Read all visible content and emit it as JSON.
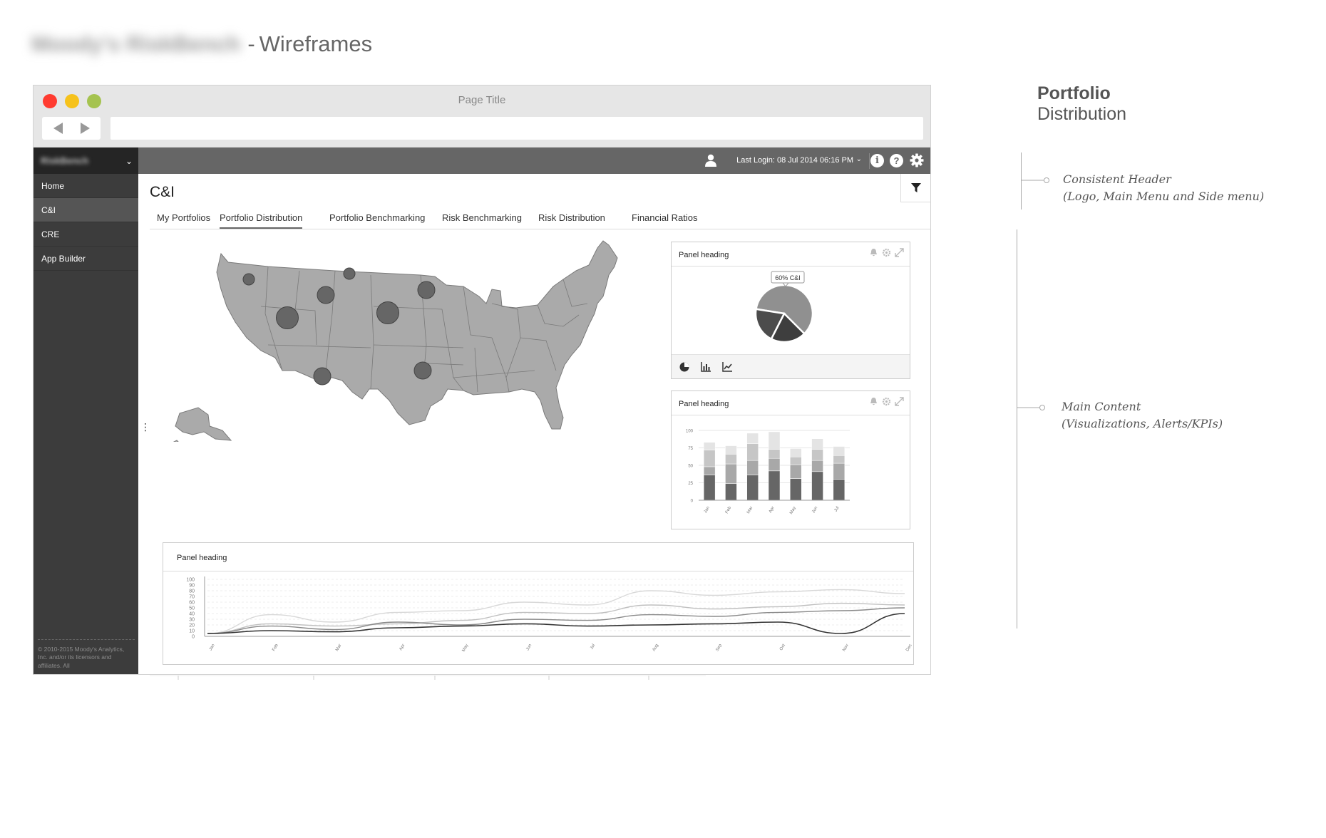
{
  "doc": {
    "title_blurred": "Moody's RiskBench",
    "title_dash": "-",
    "title": "Wireframes"
  },
  "browser": {
    "page_title": "Page Title",
    "url": ""
  },
  "app": {
    "logo_text": "RiskBench",
    "sidebar": {
      "items": [
        {
          "label": "Home",
          "active": false
        },
        {
          "label": "C&I",
          "active": true
        },
        {
          "label": "CRE",
          "active": false
        },
        {
          "label": "App Builder",
          "active": false
        }
      ],
      "copyright": "© 2010-2015 Moody's Analytics, Inc. and/or its licensors and affiliates. All"
    },
    "topbar": {
      "last_login": "Last Login: 08 Jul 2014 06:16 PM",
      "icons": [
        "user-icon",
        "info-icon",
        "help-icon",
        "gear-icon"
      ]
    },
    "section_title": "C&I",
    "tabs": [
      {
        "label": "My Portfolios",
        "active": false
      },
      {
        "label": "Portfolio Distribution",
        "active": true
      },
      {
        "label": "Portfolio Benchmarking",
        "active": false
      },
      {
        "label": "Risk Benchmarking",
        "active": false
      },
      {
        "label": "Risk Distribution",
        "active": false
      },
      {
        "label": "Financial Ratios",
        "active": false
      }
    ],
    "panels": {
      "pie": {
        "heading": "Panel heading",
        "tooltip": "60% C&I"
      },
      "bar": {
        "heading": "Panel heading"
      },
      "line": {
        "heading": "Panel heading"
      }
    }
  },
  "colors": {
    "sidebar": "#3c3c3c",
    "topbar": "#666666",
    "map_fill": "#aaaaaa",
    "bubble": "#666666",
    "dot_red": "#ff3b30",
    "dot_yellow": "#f6c21b",
    "dot_green": "#a5c34f"
  },
  "annotations": {
    "title_bold": "Portfolio",
    "title_normal": "Distribution",
    "notes": [
      {
        "line1": "Consistent Header",
        "line2": "(Logo, Main Menu and Side menu)"
      },
      {
        "line1": "Main Content",
        "line2": "(Visualizations, Alerts/KPIs)"
      }
    ]
  },
  "chart_data": [
    {
      "type": "pie",
      "title": "",
      "values": [
        0.6,
        0.2,
        0.2
      ],
      "labels": [
        "60% C&I",
        "",
        ""
      ],
      "highlight_index": 0
    },
    {
      "type": "bar",
      "title": "",
      "stacked": true,
      "categories": [
        "Jan",
        "Feb",
        "Mar",
        "Apr",
        "May",
        "Jun",
        "Jul"
      ],
      "ylim": [
        0,
        100
      ],
      "yticks": [
        0,
        25,
        50,
        75,
        100
      ],
      "series": [
        {
          "values": [
            36,
            24,
            36,
            42,
            31,
            41,
            30
          ]
        },
        {
          "values": [
            12,
            28,
            21,
            18,
            20,
            16,
            23
          ]
        },
        {
          "values": [
            24,
            14,
            24,
            13,
            11,
            16,
            11
          ]
        },
        {
          "values": [
            11,
            12,
            15,
            25,
            12,
            15,
            13
          ]
        }
      ]
    },
    {
      "type": "line",
      "title": "",
      "categories": [
        "Jan",
        "Feb",
        "Mar",
        "Apr",
        "May",
        "Jun",
        "Jul",
        "Aug",
        "Sep",
        "Oct",
        "Nov",
        "Dec"
      ],
      "ylim": [
        0,
        100
      ],
      "yticks": [
        0,
        10,
        20,
        30,
        40,
        50,
        60,
        70,
        80,
        90,
        100
      ],
      "series": [
        {
          "values": [
            5,
            38,
            25,
            42,
            45,
            60,
            55,
            80,
            72,
            78,
            82,
            75
          ]
        },
        {
          "values": [
            5,
            22,
            18,
            22,
            28,
            42,
            40,
            55,
            48,
            52,
            58,
            55
          ]
        },
        {
          "values": [
            5,
            18,
            12,
            25,
            20,
            30,
            28,
            38,
            35,
            42,
            45,
            50
          ]
        },
        {
          "values": [
            5,
            10,
            8,
            15,
            18,
            22,
            18,
            20,
            22,
            25,
            5,
            40
          ]
        }
      ]
    }
  ]
}
